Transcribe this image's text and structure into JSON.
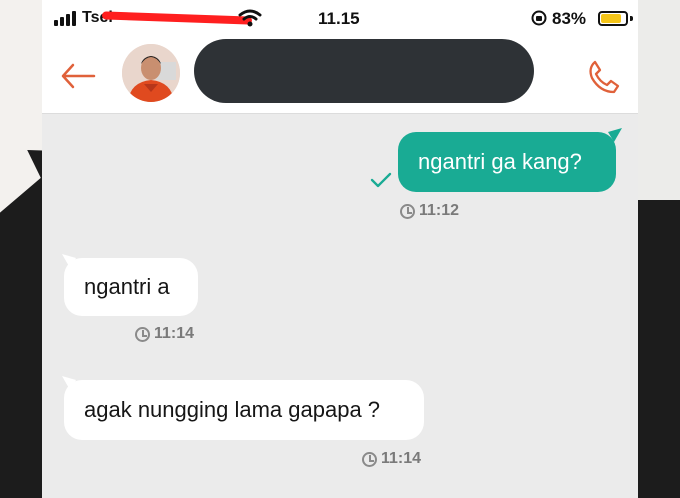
{
  "status_bar": {
    "carrier": "Tsel",
    "time": "11.15",
    "battery_percent": "83%",
    "battery_level": 0.83
  },
  "header": {
    "back_icon": "arrow-left-icon",
    "call_icon": "phone-icon",
    "accent_color": "#e0613a"
  },
  "messages": [
    {
      "direction": "outgoing",
      "text": "ngantri ga kang?",
      "time": "11:12",
      "read": true
    },
    {
      "direction": "incoming",
      "text": "ngantri a",
      "time": "11:14"
    },
    {
      "direction": "incoming",
      "text": "agak nungging lama gapapa ?",
      "time": "11:14"
    }
  ],
  "colors": {
    "outgoing_bubble": "#19ab94",
    "incoming_bubble": "#ffffff",
    "chat_background": "#ebebeb"
  }
}
